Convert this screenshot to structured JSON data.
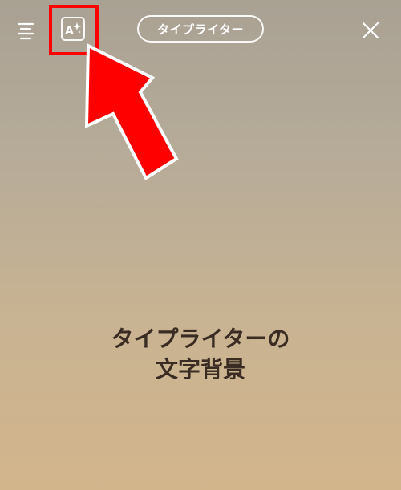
{
  "toolbar": {
    "menu_icon": "text-align-icon",
    "effect_icon": "text-effect-sparkle-icon",
    "effect_letter": "A",
    "font_style_label": "タイプライター",
    "close_icon": "close-icon"
  },
  "canvas": {
    "text_line_1": "タイプライターの",
    "text_line_2": "文字背景",
    "text_color": "#3a2c22"
  },
  "annotation": {
    "highlight_color": "#ff0000",
    "arrow_color": "#ff0000"
  }
}
